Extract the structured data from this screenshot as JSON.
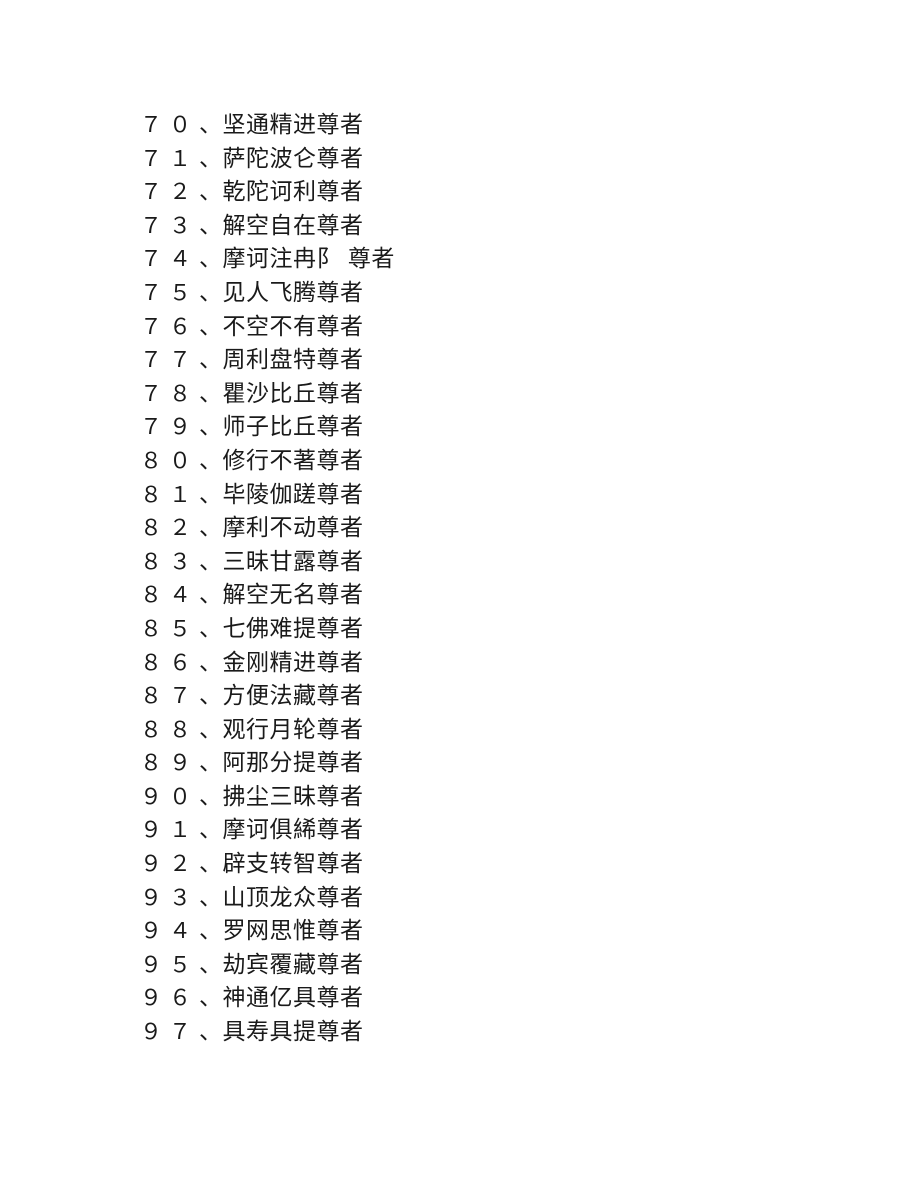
{
  "document": {
    "page_background": "#ffffff",
    "text_color": "#1a1a1a",
    "enumeration_mark": "、",
    "lines": [
      {
        "index": "７０",
        "mark": "、",
        "name": "坚通精进尊者"
      },
      {
        "index": "７１",
        "mark": "、",
        "name": "萨陀波仑尊者"
      },
      {
        "index": "７２",
        "mark": "、",
        "name": "乾陀诃利尊者"
      },
      {
        "index": "７３",
        "mark": "、",
        "name": "解空自在尊者"
      },
      {
        "index": "７４",
        "mark": "、",
        "name": "摩诃注冉阝 尊者"
      },
      {
        "index": "７５",
        "mark": "、",
        "name": "见人飞腾尊者"
      },
      {
        "index": "７６",
        "mark": "、",
        "name": "不空不有尊者"
      },
      {
        "index": "７７",
        "mark": "、",
        "name": "周利盘特尊者"
      },
      {
        "index": "７８",
        "mark": "、",
        "name": "瞿沙比丘尊者"
      },
      {
        "index": "７９",
        "mark": "、",
        "name": "师子比丘尊者"
      },
      {
        "index": "８０",
        "mark": "、",
        "name": "修行不著尊者"
      },
      {
        "index": "８１",
        "mark": "、",
        "name": "毕陵伽蹉尊者"
      },
      {
        "index": "８２",
        "mark": "、",
        "name": "摩利不动尊者"
      },
      {
        "index": "８３",
        "mark": "、",
        "name": "三昧甘露尊者"
      },
      {
        "index": "８４",
        "mark": "、",
        "name": "解空无名尊者"
      },
      {
        "index": "８５",
        "mark": "、",
        "name": "七佛难提尊者"
      },
      {
        "index": "８６",
        "mark": "、",
        "name": "金刚精进尊者"
      },
      {
        "index": "８７",
        "mark": "、",
        "name": "方便法藏尊者"
      },
      {
        "index": "８８",
        "mark": "、",
        "name": "观行月轮尊者"
      },
      {
        "index": "８９",
        "mark": "、",
        "name": "阿那分提尊者"
      },
      {
        "index": "９０",
        "mark": "、",
        "name": "拂尘三昧尊者"
      },
      {
        "index": "９１",
        "mark": "、",
        "name": "摩诃俱絺尊者"
      },
      {
        "index": "９２",
        "mark": "、",
        "name": "辟支转智尊者"
      },
      {
        "index": "９３",
        "mark": "、",
        "name": "山顶龙众尊者"
      },
      {
        "index": "９４",
        "mark": "、",
        "name": "罗网思惟尊者"
      },
      {
        "index": "９５",
        "mark": "、",
        "name": "劫宾覆藏尊者"
      },
      {
        "index": "９６",
        "mark": "、",
        "name": "神通亿具尊者"
      },
      {
        "index": "９７",
        "mark": "、",
        "name": "具寿具提尊者"
      }
    ]
  }
}
